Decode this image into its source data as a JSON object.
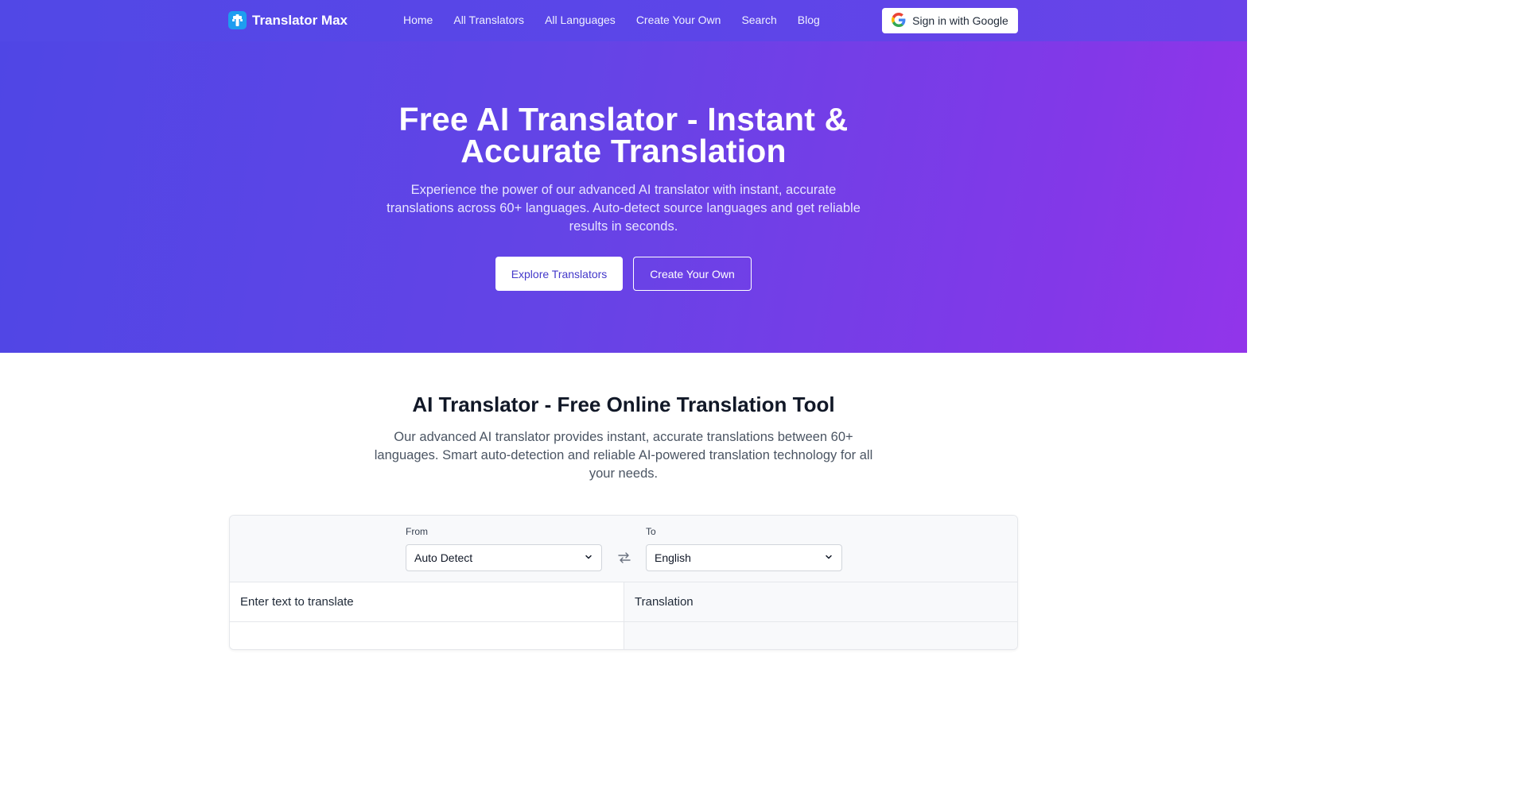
{
  "brand": {
    "name": "Translator Max"
  },
  "nav": {
    "items": [
      "Home",
      "All Translators",
      "All Languages",
      "Create Your Own",
      "Search",
      "Blog"
    ]
  },
  "auth": {
    "google_label": "Sign in with Google"
  },
  "hero": {
    "title": "Free AI Translator - Instant & Accurate Translation",
    "subtitle": "Experience the power of our advanced AI translator with instant, accurate translations across 60+ languages. Auto-detect source languages and get reliable results in seconds.",
    "primary_button": "Explore Translators",
    "secondary_button": "Create Your Own"
  },
  "section": {
    "title": "AI Translator - Free Online Translation Tool",
    "description": "Our advanced AI translator provides instant, accurate translations between 60+ languages. Smart auto-detection and reliable AI-powered translation technology for all your needs."
  },
  "translator": {
    "from_label": "From",
    "from_value": "Auto Detect",
    "to_label": "To",
    "to_value": "English",
    "input_header": "Enter text to translate",
    "output_header": "Translation"
  },
  "colors": {
    "nav_bg": "#5148e6",
    "hero_start": "#4f46e5",
    "hero_end": "#9235ea",
    "accent_text": "#4338ca",
    "logo_bg": "#1e9df0"
  }
}
